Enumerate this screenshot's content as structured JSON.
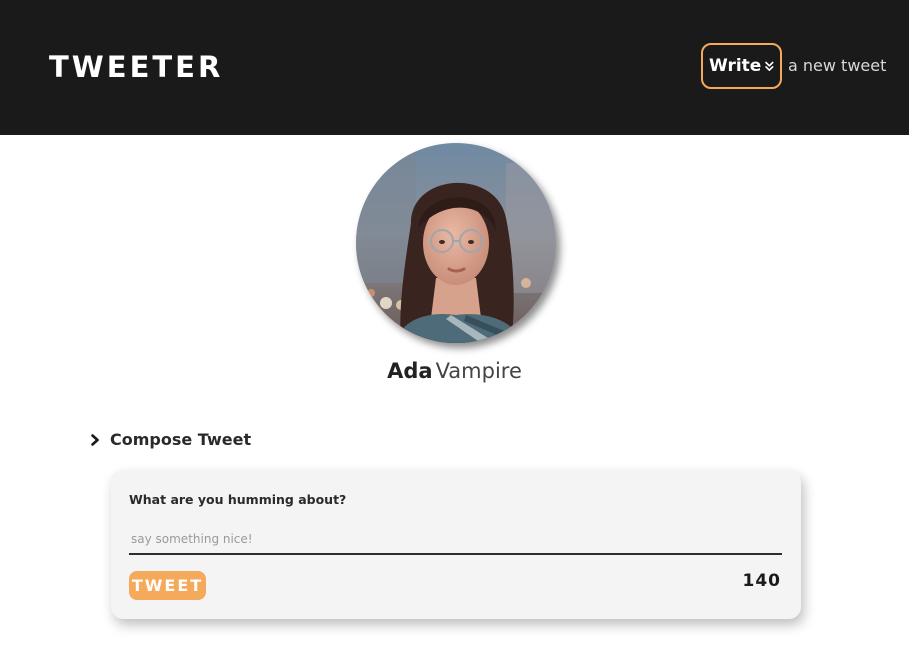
{
  "header": {
    "logo": "TWEETER",
    "write_button_label": "Write",
    "write_button_icon": "double-chevron-down-icon",
    "write_caption": "a new tweet"
  },
  "profile": {
    "avatar_icon": "profile-photo",
    "first_name": "Ada",
    "last_name": "Vampire"
  },
  "compose": {
    "toggle_icon": "chevron-right-icon",
    "title": "Compose Tweet",
    "prompt": "What are you humming about?",
    "input_value": "",
    "input_placeholder": "say something nice!",
    "submit_label": "TWEET",
    "char_counter": "140"
  },
  "colors": {
    "navbar_bg": "#1a1a1a",
    "accent": "#f4a95b",
    "card_bg": "#f4f4f4"
  }
}
